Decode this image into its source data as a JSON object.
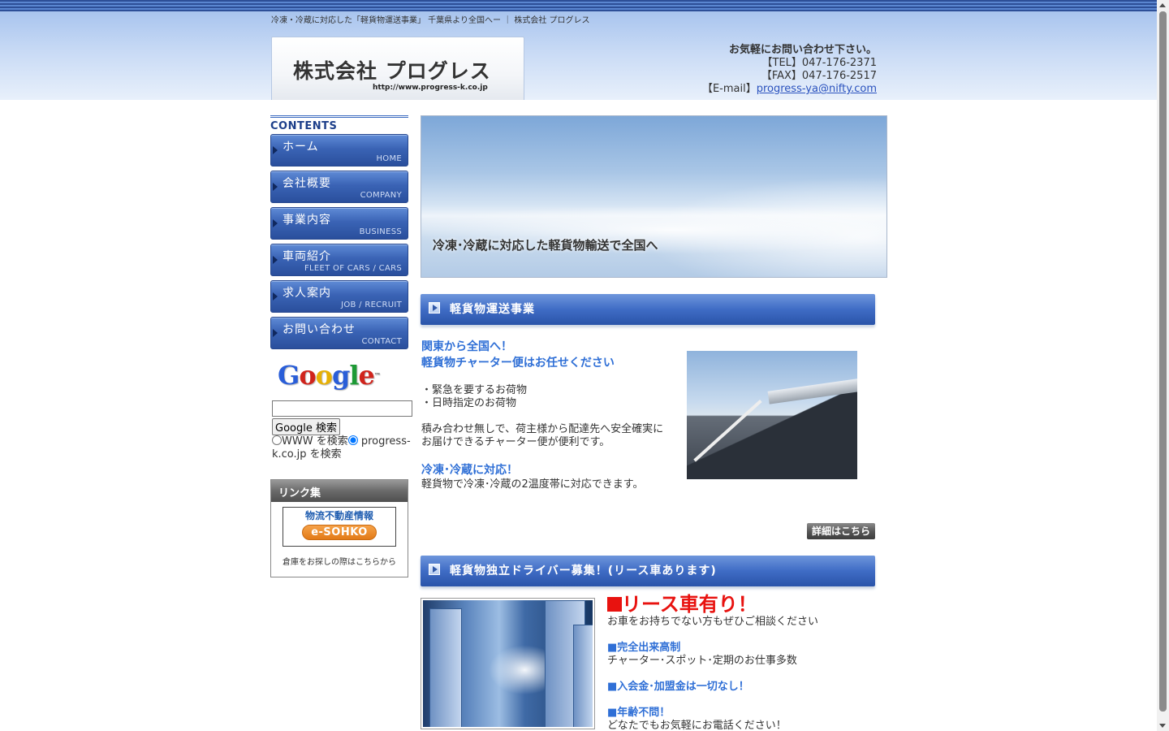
{
  "header": {
    "tagline": "冷凍・冷蔵に対応した「軽貨物運送事業」 千葉県より全国へー ｜ 株式会社 プログレス",
    "logo_text": "株式会社 プログレス",
    "logo_url": "http://www.progress-k.co.jp",
    "contact_lead": "お気軽にお問い合わせ下さい。",
    "tel": "【TEL】047-176-2371",
    "fax": "【FAX】047-176-2517",
    "email_label": "【E-mail】",
    "email": "progress-ya@nifty.com"
  },
  "sidebar": {
    "contents_label": "CONTENTS",
    "items": [
      {
        "jp": "ホーム",
        "en": "HOME"
      },
      {
        "jp": "会社概要",
        "en": "COMPANY"
      },
      {
        "jp": "事業内容",
        "en": "BUSINESS"
      },
      {
        "jp": "車両紹介",
        "en": "FLEET OF CARS / CARS"
      },
      {
        "jp": "求人案内",
        "en": "JOB / RECRUIT"
      },
      {
        "jp": "お問い合わせ",
        "en": "CONTACT"
      }
    ],
    "google": {
      "logo": "Google",
      "button": "Google 検索",
      "radio_www": "WWW を検索",
      "radio_site": "progress-k.co.jp を検索",
      "query": ""
    },
    "links": {
      "title": "リンク集",
      "banner_top": "物流不動産情報",
      "banner_logo": "e-SOHKO",
      "caption": "倉庫をお探しの際はこちらから"
    }
  },
  "hero": {
    "caption": "冷凍･冷蔵に対応した軽貨物輸送で全国へ"
  },
  "section1": {
    "title": "軽貨物運送事業",
    "headline1": "関東から全国へ！",
    "headline2": "軽貨物チャーター便はお任せください",
    "bullet1": "・緊急を要するお荷物",
    "bullet2": "・日時指定のお荷物",
    "para1": "積み合わせ無しで、荷主様から配達先へ安全確実にお届けできるチャーター便が便利です。",
    "subhead": "冷凍･冷蔵に対応！",
    "para2": "軽貨物で冷凍･冷蔵の2温度帯に対応できます。",
    "detail_button": "詳細はこちら"
  },
  "section2": {
    "title": "軽貨物独立ドライバー募集！(リース車あります)",
    "red_head": "リース車有り！",
    "line1": "お車をお持ちでない方もぜひご相談ください",
    "b1": "■完全出来高制",
    "l2": "チャーター･スポット･定期のお仕事多数",
    "b2": "■入会金･加盟金は一切なし！",
    "b3": "■年齢不問！",
    "l3": "どなたでもお気軽にお電話ください！"
  },
  "colors": {
    "nav_blue": "#3a63b5",
    "accent_blue": "#2f6fd6",
    "red": "#e8120f"
  }
}
